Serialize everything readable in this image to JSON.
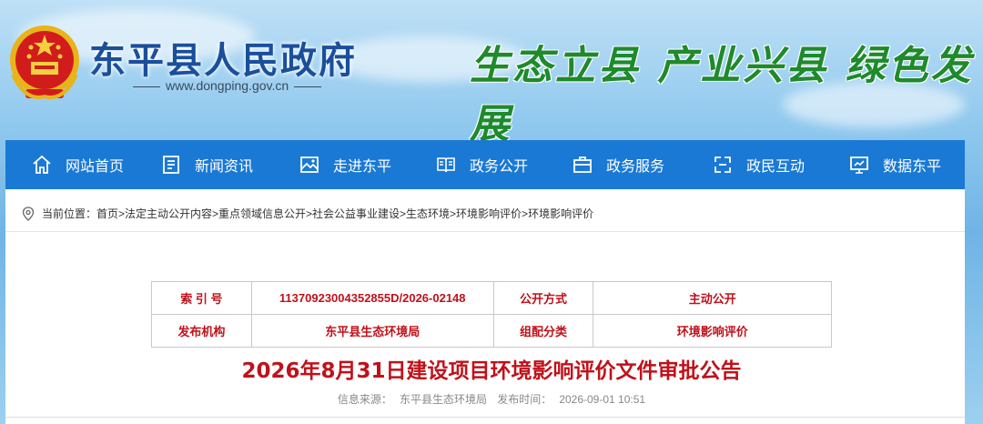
{
  "header": {
    "site_title": "东平县人民政府",
    "site_url": "www.dongping.gov.cn",
    "slogan": "生态立县 产业兴县 绿色发展",
    "emblem_icon": "national-emblem-icon"
  },
  "nav": {
    "items": [
      {
        "label": "网站首页",
        "icon": "home-icon"
      },
      {
        "label": "新闻资讯",
        "icon": "news-icon"
      },
      {
        "label": "走进东平",
        "icon": "image-icon"
      },
      {
        "label": "政务公开",
        "icon": "book-icon"
      },
      {
        "label": "政务服务",
        "icon": "briefcase-icon"
      },
      {
        "label": "政民互动",
        "icon": "interaction-icon"
      },
      {
        "label": "数据东平",
        "icon": "monitor-icon"
      }
    ]
  },
  "breadcrumb": {
    "prefix": "当前位置：",
    "path": "首页>法定主动公开内容>重点领域信息公开>社会公益事业建设>生态环境>环境影响评价>环境影响评价"
  },
  "meta": {
    "index_label": "索 引 号",
    "index_value": "11370923004352855D/2026-02148",
    "method_label": "公开方式",
    "method_value": "主动公开",
    "publisher_label": "发布机构",
    "publisher_value": "东平县生态环境局",
    "category_label": "组配分类",
    "category_value": "环境影响评价"
  },
  "article": {
    "title": "2026年8月31日建设项目环境影响评价文件审批公告",
    "source_label": "信息来源：",
    "source_value": "东平县生态环境局",
    "time_label": "发布时间：",
    "time_value": "2026-09-01 10:51"
  },
  "colors": {
    "nav_bg": "#1a79d4",
    "title_red": "#c0111a",
    "site_title_blue": "#1a4f9c",
    "slogan_green": "#1e8a2c"
  }
}
